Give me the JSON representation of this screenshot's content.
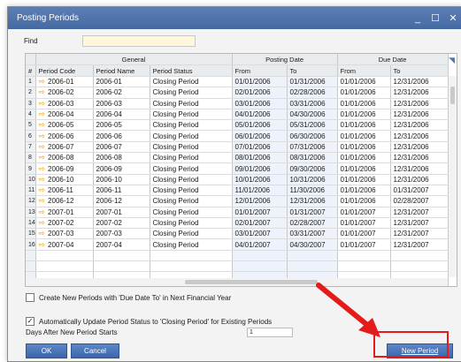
{
  "window": {
    "title": "Posting Periods",
    "minimize_label": "_",
    "maximize_label": "☐",
    "close_label": "✕"
  },
  "find": {
    "label": "Find",
    "value": ""
  },
  "grid": {
    "group_headers": {
      "general": "General",
      "posting_date": "Posting Date",
      "due_date": "Due Date"
    },
    "columns": [
      "#",
      "Period Code",
      "Period Name",
      "Period Status",
      "From",
      "To",
      "From",
      "To"
    ],
    "rows": [
      [
        "1",
        "2006-01",
        "2006-01",
        "Closing Period",
        "01/01/2006",
        "01/31/2006",
        "01/01/2006",
        "12/31/2006"
      ],
      [
        "2",
        "2006-02",
        "2006-02",
        "Closing Period",
        "02/01/2006",
        "02/28/2006",
        "01/01/2006",
        "12/31/2006"
      ],
      [
        "3",
        "2006-03",
        "2006-03",
        "Closing Period",
        "03/01/2006",
        "03/31/2006",
        "01/01/2006",
        "12/31/2006"
      ],
      [
        "4",
        "2006-04",
        "2006-04",
        "Closing Period",
        "04/01/2006",
        "04/30/2006",
        "01/01/2006",
        "12/31/2006"
      ],
      [
        "5",
        "2006-05",
        "2006-05",
        "Closing Period",
        "05/01/2006",
        "05/31/2006",
        "01/01/2006",
        "12/31/2006"
      ],
      [
        "6",
        "2006-06",
        "2006-06",
        "Closing Period",
        "06/01/2006",
        "06/30/2006",
        "01/01/2006",
        "12/31/2006"
      ],
      [
        "7",
        "2006-07",
        "2006-07",
        "Closing Period",
        "07/01/2006",
        "07/31/2006",
        "01/01/2006",
        "12/31/2006"
      ],
      [
        "8",
        "2006-08",
        "2006-08",
        "Closing Period",
        "08/01/2006",
        "08/31/2006",
        "01/01/2006",
        "12/31/2006"
      ],
      [
        "9",
        "2006-09",
        "2006-09",
        "Closing Period",
        "09/01/2006",
        "09/30/2006",
        "01/01/2006",
        "12/31/2006"
      ],
      [
        "10",
        "2006-10",
        "2006-10",
        "Closing Period",
        "10/01/2006",
        "10/31/2006",
        "01/01/2006",
        "12/31/2006"
      ],
      [
        "11",
        "2006-11",
        "2006-11",
        "Closing Period",
        "11/01/2006",
        "11/30/2006",
        "01/01/2006",
        "01/31/2007"
      ],
      [
        "12",
        "2006-12",
        "2006-12",
        "Closing Period",
        "12/01/2006",
        "12/31/2006",
        "01/01/2006",
        "02/28/2007"
      ],
      [
        "13",
        "2007-01",
        "2007-01",
        "Closing Period",
        "01/01/2007",
        "01/31/2007",
        "01/01/2007",
        "12/31/2007"
      ],
      [
        "14",
        "2007-02",
        "2007-02",
        "Closing Period",
        "02/01/2007",
        "02/28/2007",
        "01/01/2007",
        "12/31/2007"
      ],
      [
        "15",
        "2007-03",
        "2007-03",
        "Closing Period",
        "03/01/2007",
        "03/31/2007",
        "01/01/2007",
        "12/31/2007"
      ],
      [
        "16",
        "2007-04",
        "2007-04",
        "Closing Period",
        "04/01/2007",
        "04/30/2007",
        "01/01/2007",
        "12/31/2007"
      ],
      [
        "",
        "",
        "",
        "",
        "",
        "",
        "",
        ""
      ],
      [
        "",
        "",
        "",
        "",
        "",
        "",
        "",
        ""
      ],
      [
        "",
        "",
        "",
        "",
        "",
        "",
        "",
        ""
      ],
      [
        "",
        "",
        "",
        "",
        "",
        "",
        "",
        ""
      ]
    ]
  },
  "options": {
    "create_new_periods": {
      "label": "Create New Periods with 'Due Date To' in Next Financial Year",
      "checked": false
    },
    "auto_update_status": {
      "label": "Automatically Update Period Status to 'Closing Period' for Existing Periods",
      "checked": true
    },
    "days_after": {
      "label": "Days After New Period Starts",
      "value": "1"
    }
  },
  "buttons": {
    "ok": "OK",
    "cancel": "Cancel",
    "new_period": "New Period"
  },
  "colors": {
    "titlebar": "#456aa3",
    "button": "#3d66aa",
    "highlight": "#e31b1b",
    "arrow_icon": "#f0a000"
  }
}
